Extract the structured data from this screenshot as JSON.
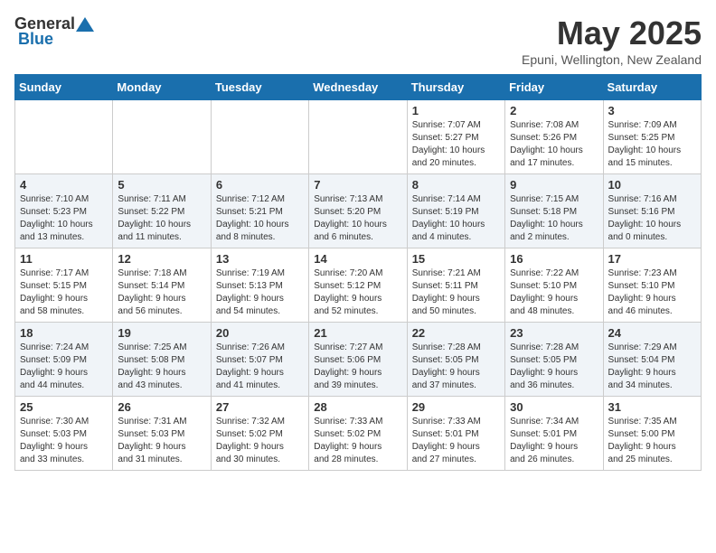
{
  "header": {
    "logo_general": "General",
    "logo_blue": "Blue",
    "title": "May 2025",
    "subtitle": "Epuni, Wellington, New Zealand"
  },
  "weekdays": [
    "Sunday",
    "Monday",
    "Tuesday",
    "Wednesday",
    "Thursday",
    "Friday",
    "Saturday"
  ],
  "weeks": [
    [
      {
        "day": "",
        "info": ""
      },
      {
        "day": "",
        "info": ""
      },
      {
        "day": "",
        "info": ""
      },
      {
        "day": "",
        "info": ""
      },
      {
        "day": "1",
        "info": "Sunrise: 7:07 AM\nSunset: 5:27 PM\nDaylight: 10 hours\nand 20 minutes."
      },
      {
        "day": "2",
        "info": "Sunrise: 7:08 AM\nSunset: 5:26 PM\nDaylight: 10 hours\nand 17 minutes."
      },
      {
        "day": "3",
        "info": "Sunrise: 7:09 AM\nSunset: 5:25 PM\nDaylight: 10 hours\nand 15 minutes."
      }
    ],
    [
      {
        "day": "4",
        "info": "Sunrise: 7:10 AM\nSunset: 5:23 PM\nDaylight: 10 hours\nand 13 minutes."
      },
      {
        "day": "5",
        "info": "Sunrise: 7:11 AM\nSunset: 5:22 PM\nDaylight: 10 hours\nand 11 minutes."
      },
      {
        "day": "6",
        "info": "Sunrise: 7:12 AM\nSunset: 5:21 PM\nDaylight: 10 hours\nand 8 minutes."
      },
      {
        "day": "7",
        "info": "Sunrise: 7:13 AM\nSunset: 5:20 PM\nDaylight: 10 hours\nand 6 minutes."
      },
      {
        "day": "8",
        "info": "Sunrise: 7:14 AM\nSunset: 5:19 PM\nDaylight: 10 hours\nand 4 minutes."
      },
      {
        "day": "9",
        "info": "Sunrise: 7:15 AM\nSunset: 5:18 PM\nDaylight: 10 hours\nand 2 minutes."
      },
      {
        "day": "10",
        "info": "Sunrise: 7:16 AM\nSunset: 5:16 PM\nDaylight: 10 hours\nand 0 minutes."
      }
    ],
    [
      {
        "day": "11",
        "info": "Sunrise: 7:17 AM\nSunset: 5:15 PM\nDaylight: 9 hours\nand 58 minutes."
      },
      {
        "day": "12",
        "info": "Sunrise: 7:18 AM\nSunset: 5:14 PM\nDaylight: 9 hours\nand 56 minutes."
      },
      {
        "day": "13",
        "info": "Sunrise: 7:19 AM\nSunset: 5:13 PM\nDaylight: 9 hours\nand 54 minutes."
      },
      {
        "day": "14",
        "info": "Sunrise: 7:20 AM\nSunset: 5:12 PM\nDaylight: 9 hours\nand 52 minutes."
      },
      {
        "day": "15",
        "info": "Sunrise: 7:21 AM\nSunset: 5:11 PM\nDaylight: 9 hours\nand 50 minutes."
      },
      {
        "day": "16",
        "info": "Sunrise: 7:22 AM\nSunset: 5:10 PM\nDaylight: 9 hours\nand 48 minutes."
      },
      {
        "day": "17",
        "info": "Sunrise: 7:23 AM\nSunset: 5:10 PM\nDaylight: 9 hours\nand 46 minutes."
      }
    ],
    [
      {
        "day": "18",
        "info": "Sunrise: 7:24 AM\nSunset: 5:09 PM\nDaylight: 9 hours\nand 44 minutes."
      },
      {
        "day": "19",
        "info": "Sunrise: 7:25 AM\nSunset: 5:08 PM\nDaylight: 9 hours\nand 43 minutes."
      },
      {
        "day": "20",
        "info": "Sunrise: 7:26 AM\nSunset: 5:07 PM\nDaylight: 9 hours\nand 41 minutes."
      },
      {
        "day": "21",
        "info": "Sunrise: 7:27 AM\nSunset: 5:06 PM\nDaylight: 9 hours\nand 39 minutes."
      },
      {
        "day": "22",
        "info": "Sunrise: 7:28 AM\nSunset: 5:05 PM\nDaylight: 9 hours\nand 37 minutes."
      },
      {
        "day": "23",
        "info": "Sunrise: 7:28 AM\nSunset: 5:05 PM\nDaylight: 9 hours\nand 36 minutes."
      },
      {
        "day": "24",
        "info": "Sunrise: 7:29 AM\nSunset: 5:04 PM\nDaylight: 9 hours\nand 34 minutes."
      }
    ],
    [
      {
        "day": "25",
        "info": "Sunrise: 7:30 AM\nSunset: 5:03 PM\nDaylight: 9 hours\nand 33 minutes."
      },
      {
        "day": "26",
        "info": "Sunrise: 7:31 AM\nSunset: 5:03 PM\nDaylight: 9 hours\nand 31 minutes."
      },
      {
        "day": "27",
        "info": "Sunrise: 7:32 AM\nSunset: 5:02 PM\nDaylight: 9 hours\nand 30 minutes."
      },
      {
        "day": "28",
        "info": "Sunrise: 7:33 AM\nSunset: 5:02 PM\nDaylight: 9 hours\nand 28 minutes."
      },
      {
        "day": "29",
        "info": "Sunrise: 7:33 AM\nSunset: 5:01 PM\nDaylight: 9 hours\nand 27 minutes."
      },
      {
        "day": "30",
        "info": "Sunrise: 7:34 AM\nSunset: 5:01 PM\nDaylight: 9 hours\nand 26 minutes."
      },
      {
        "day": "31",
        "info": "Sunrise: 7:35 AM\nSunset: 5:00 PM\nDaylight: 9 hours\nand 25 minutes."
      }
    ]
  ]
}
